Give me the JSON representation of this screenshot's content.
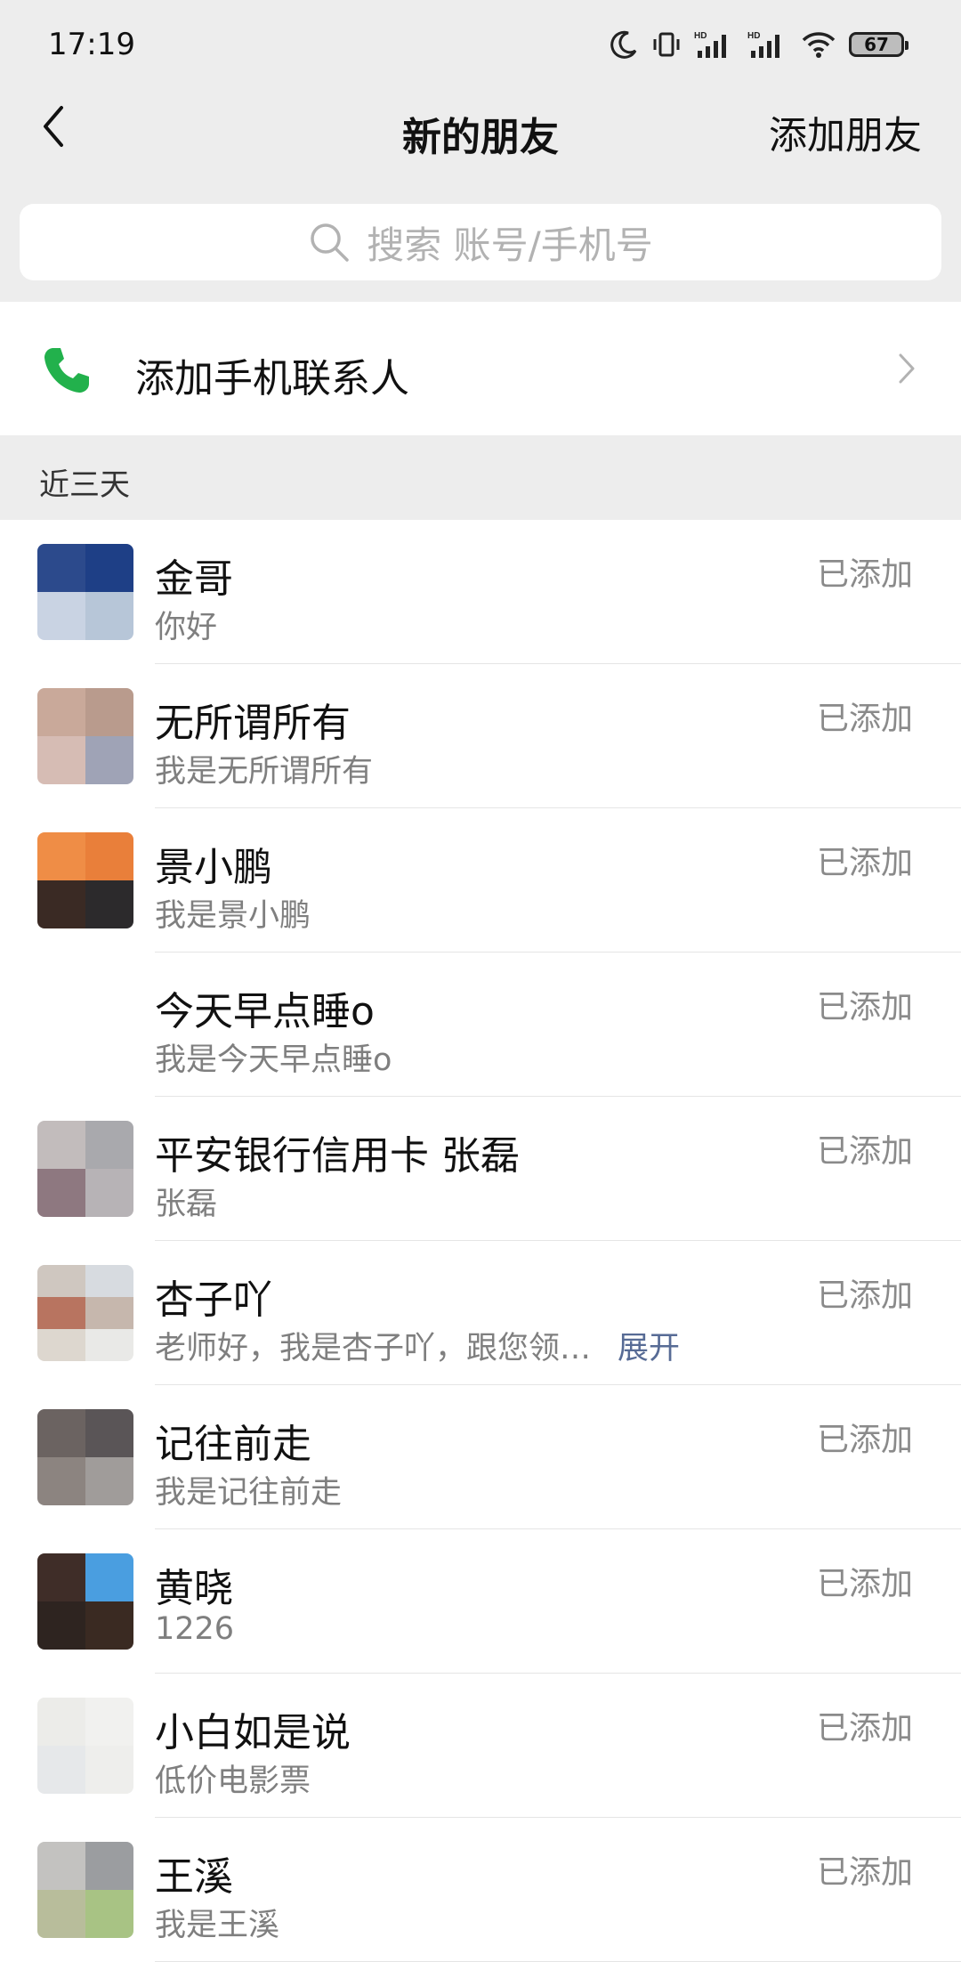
{
  "status_bar": {
    "time": "17:19",
    "battery": "67"
  },
  "nav": {
    "title": "新的朋友",
    "action": "添加朋友"
  },
  "search": {
    "placeholder": "搜索 账号/手机号"
  },
  "add_contacts": {
    "label": "添加手机联系人"
  },
  "section": {
    "title": "近三天"
  },
  "friends": [
    {
      "name": "金哥",
      "message": "你好",
      "status": "已添加",
      "avatar": [
        "#2c4a8c",
        "#1e3f86",
        "#c9d3e3",
        "#b7c6d8"
      ]
    },
    {
      "name": "无所谓所有",
      "message": "我是无所谓所有",
      "status": "已添加",
      "avatar": [
        "#c9a99a",
        "#b99b8d",
        "#d6bcb4",
        "#9fa3b6"
      ]
    },
    {
      "name": "景小鹏",
      "message": "我是景小鹏",
      "status": "已添加",
      "avatar": [
        "#ef8d46",
        "#e97f3a",
        "#3a2a24",
        "#2c2a2c"
      ]
    },
    {
      "name": "今天早点睡o",
      "message": "我是今天早点睡o",
      "status": "已添加",
      "avatar": null
    },
    {
      "name": "平安银行信用卡  张磊",
      "message": "张磊",
      "status": "已添加",
      "avatar": [
        "#c2bcbc",
        "#a9a9ad",
        "#8e7880",
        "#b7b3b6"
      ]
    },
    {
      "name": "杏子吖",
      "message": "老师好，我是杏子吖，跟您领…",
      "expand": "展开",
      "status": "已添加",
      "avatar": [
        "#cfc7c0",
        "#d7dbe0",
        "#b87460",
        "#c6b7ad",
        "#ddd7cf",
        "#e9e9e7"
      ]
    },
    {
      "name": "记往前走",
      "message": "我是记往前走",
      "status": "已添加",
      "avatar": [
        "#6b6361",
        "#5a5557",
        "#8c8480",
        "#a09c9a"
      ]
    },
    {
      "name": "黄晓",
      "message": "1226",
      "status": "已添加",
      "avatar": [
        "#3f2d28",
        "#4a9ee0",
        "#2e2420",
        "#3a2a22"
      ]
    },
    {
      "name": "小白如是说",
      "message": "低价电影票",
      "status": "已添加",
      "avatar": [
        "#ecece9",
        "#f1f1ef",
        "#e6e8ea",
        "#eeeeec"
      ]
    },
    {
      "name": "王溪",
      "message": "我是王溪",
      "status": "已添加",
      "avatar": [
        "#c3c2c0",
        "#9b9da0",
        "#b8bd9b",
        "#a8c384"
      ]
    }
  ],
  "colors": {
    "background": "#ededed",
    "accent_green": "#22b14c",
    "link_blue": "#576b95"
  }
}
